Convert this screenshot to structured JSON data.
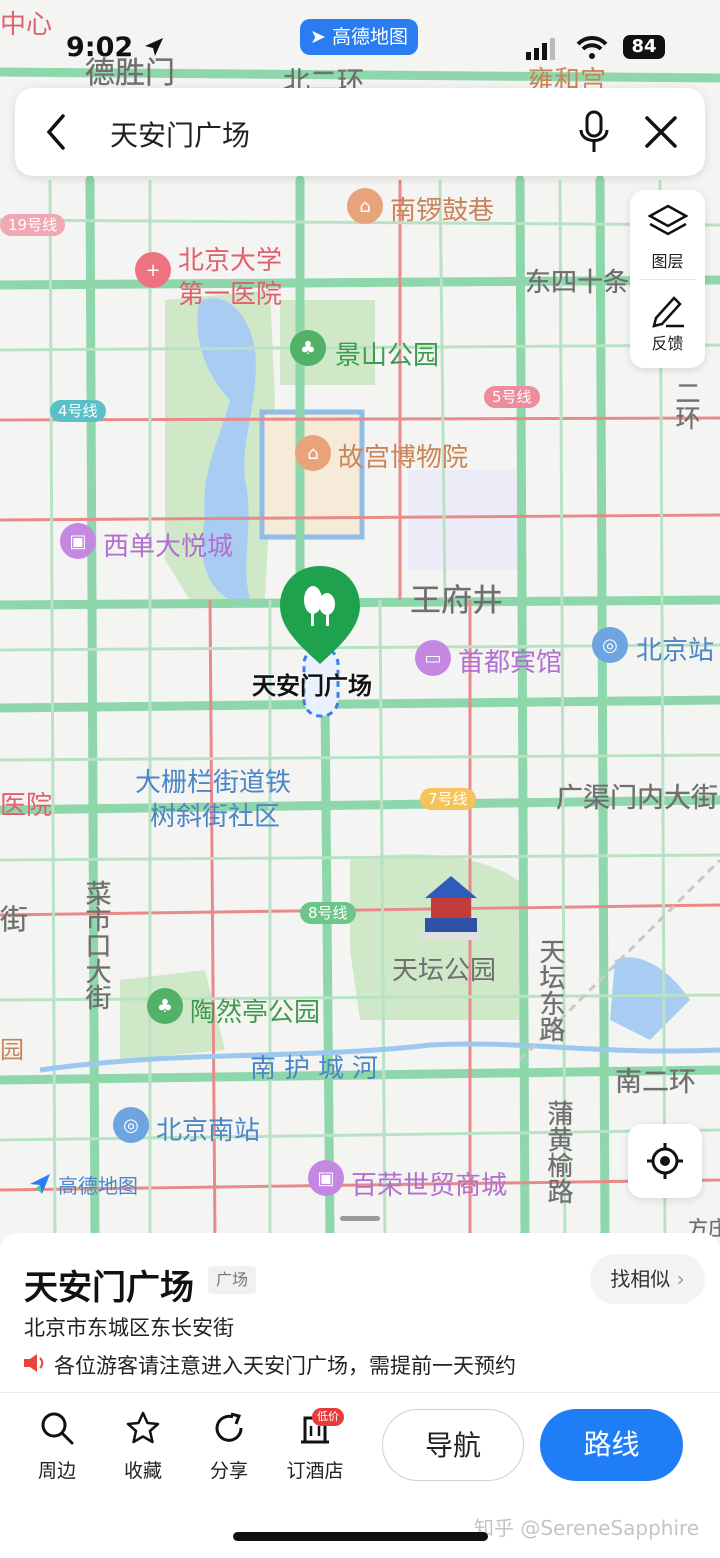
{
  "status_bar": {
    "time": "9:02",
    "app_badge": "高德地图",
    "battery": "84"
  },
  "search": {
    "value": "天安门广场"
  },
  "side_tools": {
    "layers_label": "图层",
    "feedback_label": "反馈"
  },
  "map": {
    "districts": [
      "德胜门",
      "北二环",
      "雍和宫",
      "中心"
    ],
    "labels": {
      "nanluoguxiang": "南锣鼓巷",
      "pku_hospital_1": "北京大学",
      "pku_hospital_2": "第一医院",
      "dongsishi": "东四十条",
      "jingshan": "景山公园",
      "palace": "故宫博物院",
      "xidan": "西单大悦城",
      "wangfujing": "王府井",
      "tiananmen": "天安门广场",
      "capital_hotel": "首都宾馆",
      "beijing_station": "北京站",
      "dashilan_1": "大栅栏街道铁",
      "dashilan_2": "树斜街社区",
      "guangqumen": "广渠门内大街",
      "caishikou": "菜市口大街",
      "temple_of_heaven": "天坛公园",
      "tiantan_east": "天坛东路",
      "taoranting": "陶然亭公园",
      "nanhuchenghe": "南护城河",
      "south_2nd_ring": "南二环",
      "beijing_south": "北京南站",
      "puhuangyu": "蒲黄榆路",
      "bairong": "百荣世贸商城",
      "east_2nd_ring": "二环",
      "map_logo": "高德地图",
      "partial_hospital": "医院",
      "partial_jie": "街",
      "partial_yuan": "园",
      "fangzhuang": "方庄"
    },
    "metro_lines": [
      "19号线",
      "4号线",
      "5号线",
      "7号线",
      "8号线"
    ]
  },
  "place": {
    "title": "天安门广场",
    "tag": "广场",
    "find_similar": "找相似",
    "address": "北京市东城区东长安街",
    "notice": "各位游客请注意进入天安门广场，需提前一天预约"
  },
  "actions": [
    {
      "label": "周边",
      "icon": "search-icon"
    },
    {
      "label": "收藏",
      "icon": "star-icon"
    },
    {
      "label": "分享",
      "icon": "share-icon"
    },
    {
      "label": "订酒店",
      "icon": "hotel-icon",
      "badge": "低价"
    }
  ],
  "buttons": {
    "navigate": "导航",
    "route": "路线"
  },
  "watermark": "知乎 @SereneSapphire",
  "colors": {
    "accent": "#1f7ef6",
    "pin_green": "#1fa24e",
    "road_green": "#7fd3a2"
  }
}
